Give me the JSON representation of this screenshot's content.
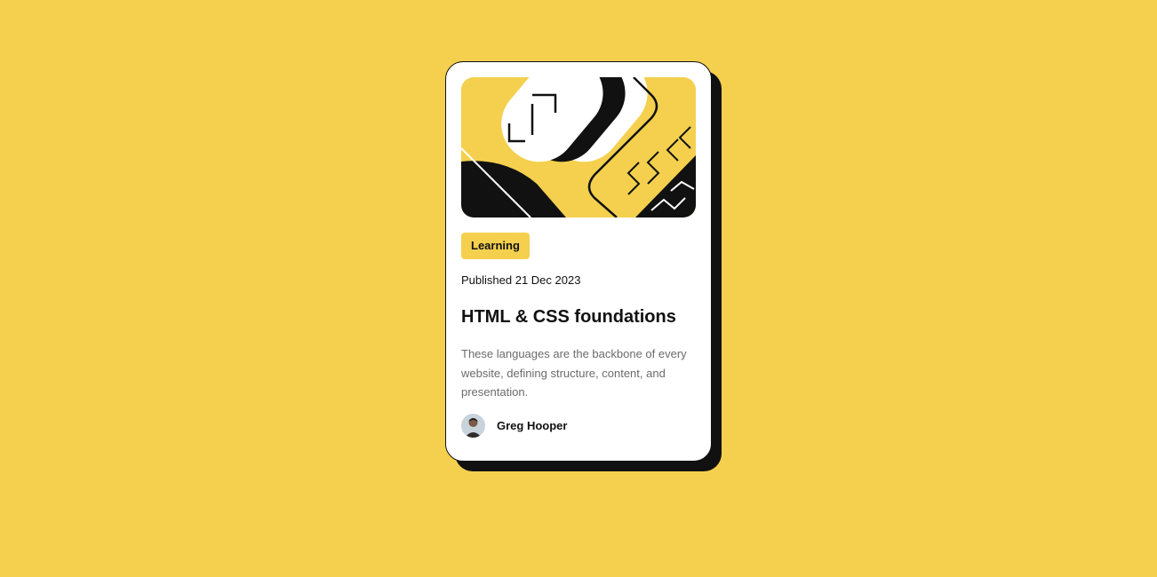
{
  "card": {
    "tag_label": "Learning",
    "published_text": "Published 21 Dec 2023",
    "title": "HTML & CSS foundations",
    "description": "These languages are the backbone of every website, defining structure, content, and presentation.",
    "author_name": "Greg Hooper"
  },
  "colors": {
    "background": "#f4d04e",
    "card": "#ffffff",
    "ink": "#111111",
    "muted_text": "#6b6b6b"
  },
  "icons": {
    "hero": "code-illustration",
    "avatar": "author-avatar"
  }
}
